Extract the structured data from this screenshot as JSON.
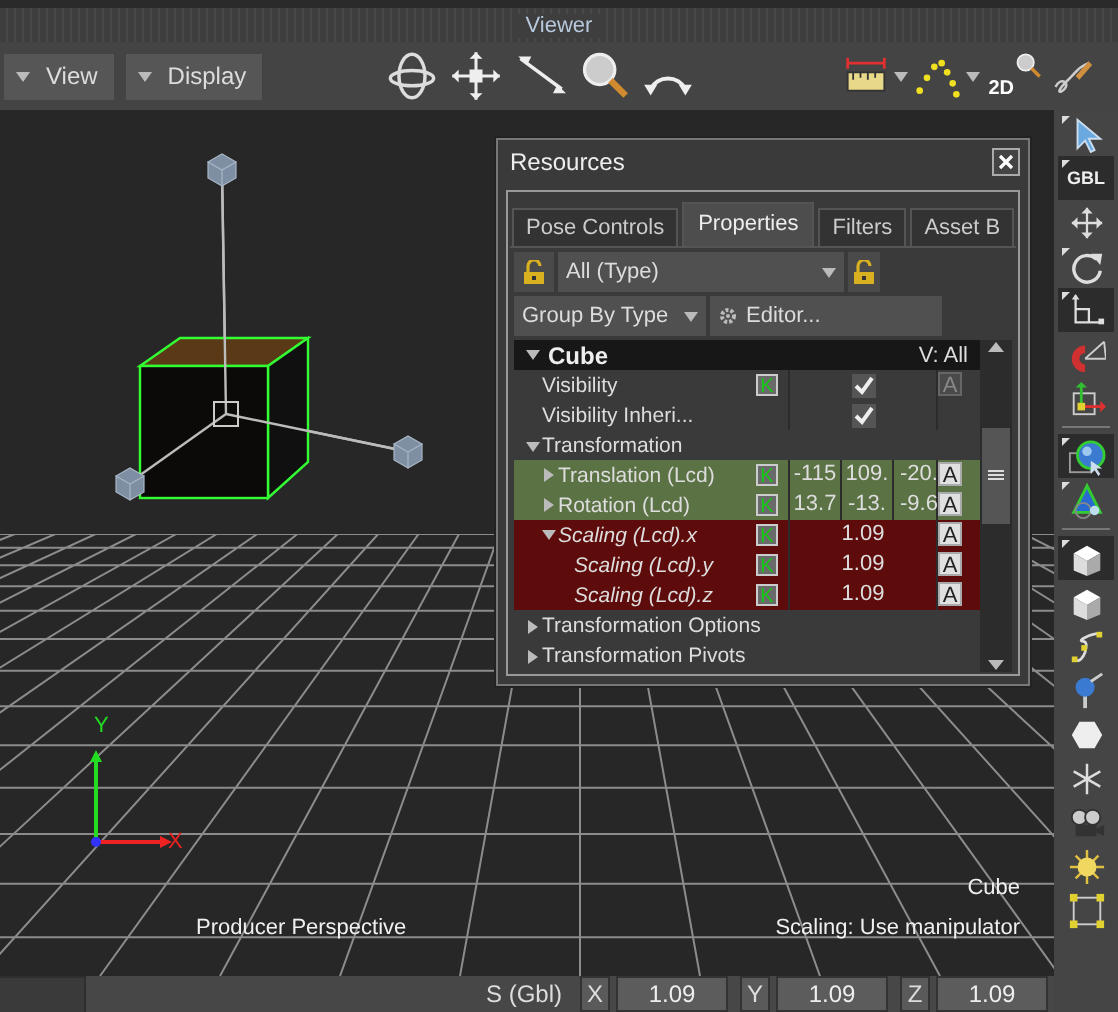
{
  "window": {
    "title": "Viewer"
  },
  "menus": [
    {
      "label": "View"
    },
    {
      "label": "Display"
    }
  ],
  "view_tools": [
    {
      "kind": "orbit"
    },
    {
      "kind": "pan"
    },
    {
      "kind": "dolly"
    },
    {
      "kind": "zoom"
    },
    {
      "kind": "roll"
    }
  ],
  "display_tools": [
    {
      "kind": "ruler",
      "dropdown": true
    },
    {
      "kind": "path",
      "dropdown": true
    },
    {
      "kind": "zoom2d",
      "label": "2D",
      "dropdown": false
    },
    {
      "kind": "sketch",
      "dropdown": false
    }
  ],
  "viewport": {
    "camera": "Producer Perspective",
    "selection": "Cube",
    "status": "Scaling: Use manipulator",
    "axis_y": "Y",
    "axis_x": "X"
  },
  "resources": {
    "title": "Resources",
    "tabs": [
      {
        "label": "Pose Controls",
        "selected": false
      },
      {
        "label": "Properties",
        "selected": true
      },
      {
        "label": "Filters",
        "selected": false
      },
      {
        "label": "Asset B",
        "selected": false
      }
    ],
    "type_filter": "All (Type)",
    "group_by": "Group By Type",
    "editor": "Editor...",
    "object": {
      "name": "Cube",
      "expanded": true,
      "visibility": "V: All"
    },
    "rows": [
      {
        "label": "Visibility",
        "kind": "toggle",
        "checked": true,
        "key": "K",
        "anim": "A",
        "anim_disabled": true
      },
      {
        "label": "Visibility Inheri...",
        "kind": "toggle",
        "checked": true
      },
      {
        "label": "Transformation",
        "kind": "group",
        "expanded": true,
        "children": [
          {
            "label": "Translation (Lcd)",
            "kind": "vector",
            "expanded": false,
            "color": "#5b7244",
            "key": "K",
            "anim": "A",
            "anim_disabled": false,
            "values": [
              "-115",
              "109.",
              "-20."
            ]
          },
          {
            "label": "Rotation (Lcd)",
            "kind": "vector",
            "expanded": false,
            "color": "#5b7244",
            "key": "K",
            "anim": "A",
            "anim_disabled": false,
            "values": [
              "13.7",
              "-13.",
              "-9.6"
            ]
          },
          {
            "label": "Scaling (Lcd).x",
            "kind": "scalar",
            "expanded": true,
            "italic": true,
            "color": "#5e0b0b",
            "key": "K",
            "anim": "A",
            "anim_disabled": false,
            "values": [
              "1.09"
            ],
            "children": [
              {
                "label": "Scaling (Lcd).y",
                "kind": "scalar",
                "italic": true,
                "color": "#5e0b0b",
                "key": "K",
                "anim": "A",
                "anim_disabled": false,
                "values": [
                  "1.09"
                ]
              },
              {
                "label": "Scaling (Lcd).z",
                "kind": "scalar",
                "italic": true,
                "color": "#5e0b0b",
                "key": "K",
                "anim": "A",
                "anim_disabled": false,
                "values": [
                  "1.09"
                ]
              }
            ]
          }
        ]
      },
      {
        "label": "Transformation Options",
        "kind": "group",
        "expanded": false
      },
      {
        "label": "Transformation Pivots",
        "kind": "group",
        "expanded": false
      }
    ]
  },
  "side_tools": [
    {
      "kind": "select",
      "selected": false,
      "flyout": true
    },
    {
      "kind": "gbl",
      "label": "GBL",
      "selected": true,
      "flyout": true
    },
    {
      "kind": "move",
      "selected": false,
      "flyout": false
    },
    {
      "kind": "rotate",
      "selected": false,
      "flyout": true
    },
    {
      "kind": "scale",
      "selected": true,
      "flyout": true
    },
    {
      "kind": "magnet",
      "selected": false,
      "flyout": false
    },
    {
      "kind": "pivot",
      "selected": false,
      "flyout": false
    },
    {
      "kind": "separator"
    },
    {
      "kind": "globe",
      "selected": true,
      "flyout": true
    },
    {
      "kind": "cone",
      "selected": false,
      "flyout": true
    },
    {
      "kind": "separator"
    },
    {
      "kind": "cube",
      "selected": true,
      "flyout": true
    },
    {
      "kind": "cube",
      "selected": false,
      "flyout": false
    },
    {
      "kind": "curve",
      "selected": false,
      "flyout": false
    },
    {
      "kind": "marker",
      "selected": false,
      "flyout": false
    },
    {
      "kind": "hexagon",
      "selected": false,
      "flyout": false
    },
    {
      "kind": "null",
      "selected": false,
      "flyout": false
    },
    {
      "kind": "camera",
      "selected": false,
      "flyout": false
    },
    {
      "kind": "light",
      "selected": false,
      "flyout": false
    },
    {
      "kind": "boxsel",
      "selected": false,
      "flyout": false
    }
  ],
  "status_bar": {
    "label": "S (Gbl)",
    "fields": [
      {
        "axis": "X",
        "value": "1.09"
      },
      {
        "axis": "Y",
        "value": "1.09"
      },
      {
        "axis": "Z",
        "value": "1.09"
      }
    ]
  }
}
